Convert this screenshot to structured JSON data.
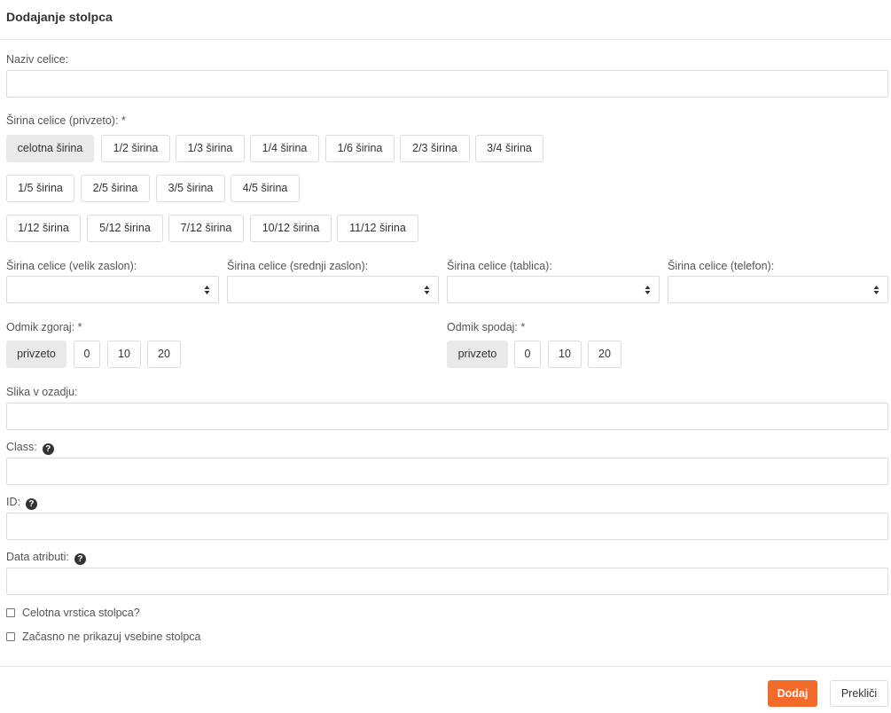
{
  "modal": {
    "title": "Dodajanje stolpca"
  },
  "cell_name": {
    "label": "Naziv celice:",
    "value": ""
  },
  "cell_width": {
    "label": "Širina celice (privzeto): *",
    "selected": "celotna širina",
    "row1": [
      "celotna širina",
      "1/2 širina",
      "1/3 širina",
      "1/4 širina",
      "1/6 širina",
      "2/3 širina",
      "3/4 širina"
    ],
    "row2": [
      "1/5 širina",
      "2/5 širina",
      "3/5 širina",
      "4/5 širina"
    ],
    "row3": [
      "1/12 širina",
      "5/12 širina",
      "7/12 širina",
      "10/12 širina",
      "11/12 širina"
    ]
  },
  "responsive_widths": [
    {
      "label": "Širina celice (velik zaslon):",
      "value": ""
    },
    {
      "label": "Širina celice (srednji zaslon):",
      "value": ""
    },
    {
      "label": "Širina celice (tablica):",
      "value": ""
    },
    {
      "label": "Širina celice (telefon):",
      "value": ""
    }
  ],
  "margin_top": {
    "label": "Odmik zgoraj: *",
    "selected": "privzeto",
    "options": [
      "privzeto",
      "0",
      "10",
      "20"
    ]
  },
  "margin_bottom": {
    "label": "Odmik spodaj: *",
    "selected": "privzeto",
    "options": [
      "privzeto",
      "0",
      "10",
      "20"
    ]
  },
  "background_image": {
    "label": "Slika v ozadju:",
    "value": ""
  },
  "css_class": {
    "label": "Class:",
    "value": ""
  },
  "element_id": {
    "label": "ID:",
    "value": ""
  },
  "data_attributes": {
    "label": "Data atributi:",
    "value": ""
  },
  "checkboxes": [
    {
      "label": "Celotna vrstica stolpca?",
      "checked": false
    },
    {
      "label": "Začasno ne prikazuj vsebine stolpca",
      "checked": false
    }
  ],
  "footer": {
    "submit_label": "Dodaj",
    "cancel_label": "Prekliči"
  },
  "icons": {
    "help": "question-circle-icon",
    "select_arrows": "sort-arrows-icon"
  },
  "colors": {
    "primary": "#f26b2a",
    "active_button": "#e9e9e9"
  }
}
